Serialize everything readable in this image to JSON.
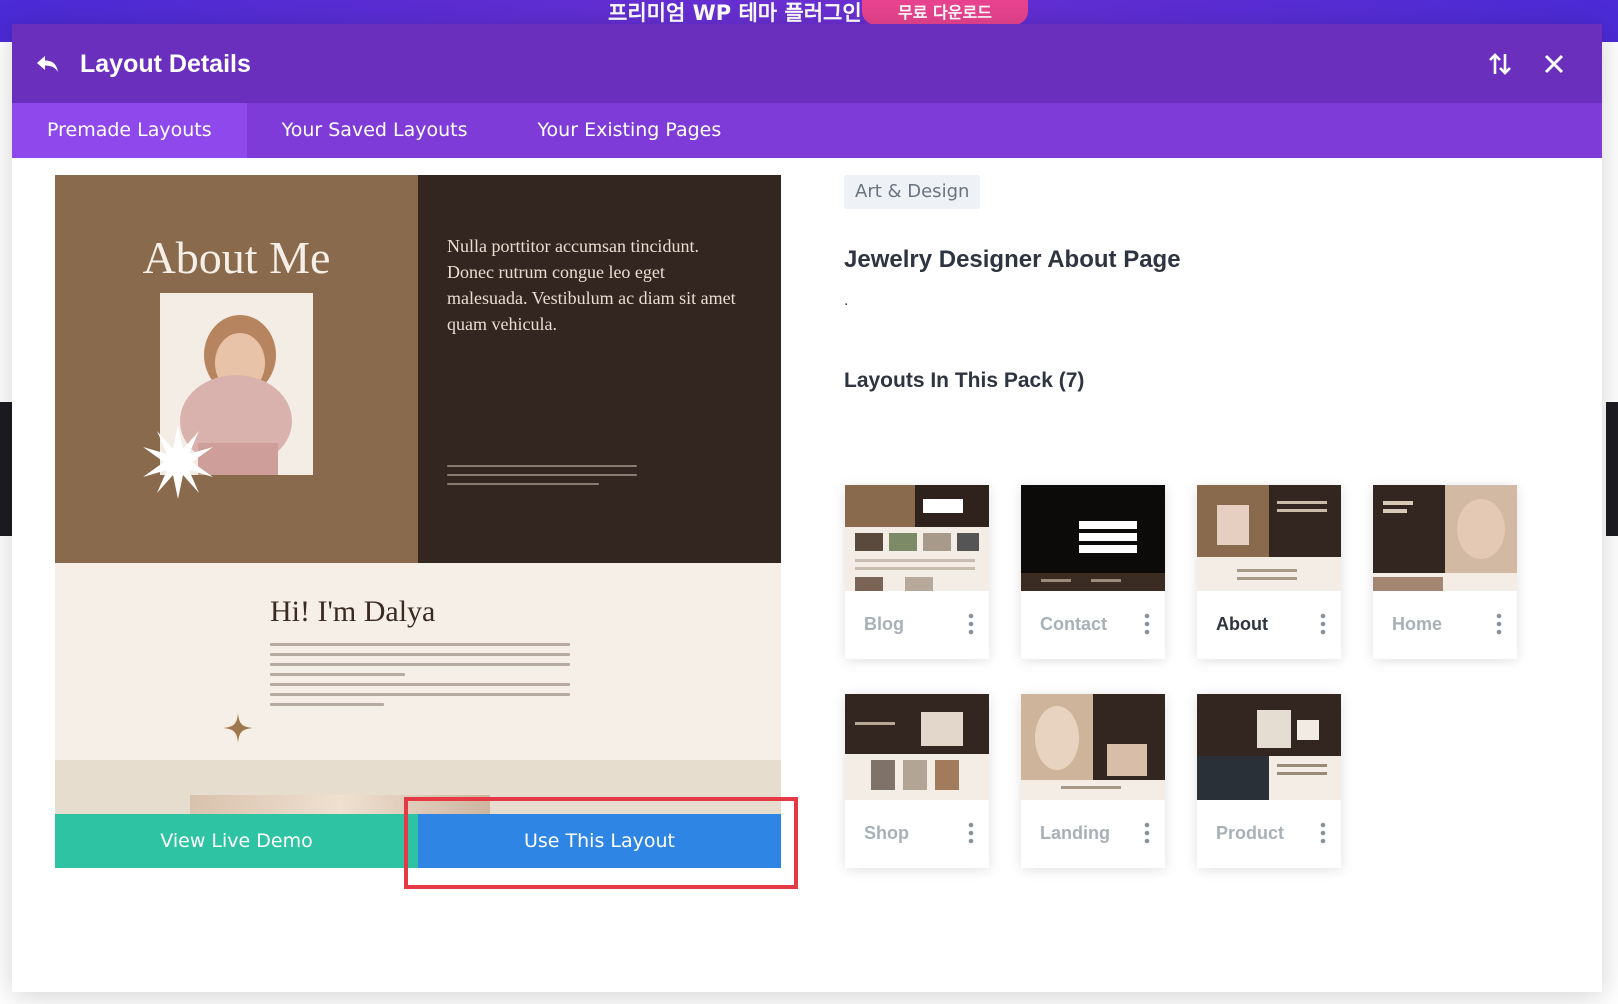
{
  "promo": {
    "text": "프리미엄 WP 테마 플러그인",
    "button_label": "무료 다운로드"
  },
  "modal": {
    "title": "Layout Details",
    "tabs": [
      {
        "label": "Premade Layouts",
        "active": true
      },
      {
        "label": "Your Saved Layouts",
        "active": false
      },
      {
        "label": "Your Existing Pages",
        "active": false
      }
    ]
  },
  "preview": {
    "heading": "About Me",
    "quote": "Nulla porttitor accumsan tincidunt. Donec rutrum congue leo eget malesuada. Vestibulum ac diam sit amet quam vehicula.",
    "greeting": "Hi! I'm Dalya"
  },
  "actions": {
    "view_demo_label": "View Live Demo",
    "use_layout_label": "Use This Layout"
  },
  "detail": {
    "category": "Art & Design",
    "name": "Jewelry Designer About Page",
    "description": ".",
    "pack_title": "Layouts In This Pack (7)"
  },
  "pack": [
    {
      "label": "Blog",
      "active": false
    },
    {
      "label": "Contact",
      "active": false
    },
    {
      "label": "About",
      "active": true
    },
    {
      "label": "Home",
      "active": false
    },
    {
      "label": "Shop",
      "active": false
    },
    {
      "label": "Landing",
      "active": false
    },
    {
      "label": "Product",
      "active": false
    }
  ],
  "colors": {
    "header": "#6b2fbe",
    "tabs": "#7e3bd7",
    "tab_active": "#8f48eb",
    "demo_button": "#2ec4a3",
    "use_button": "#2e85e3",
    "highlight": "#e53946"
  }
}
